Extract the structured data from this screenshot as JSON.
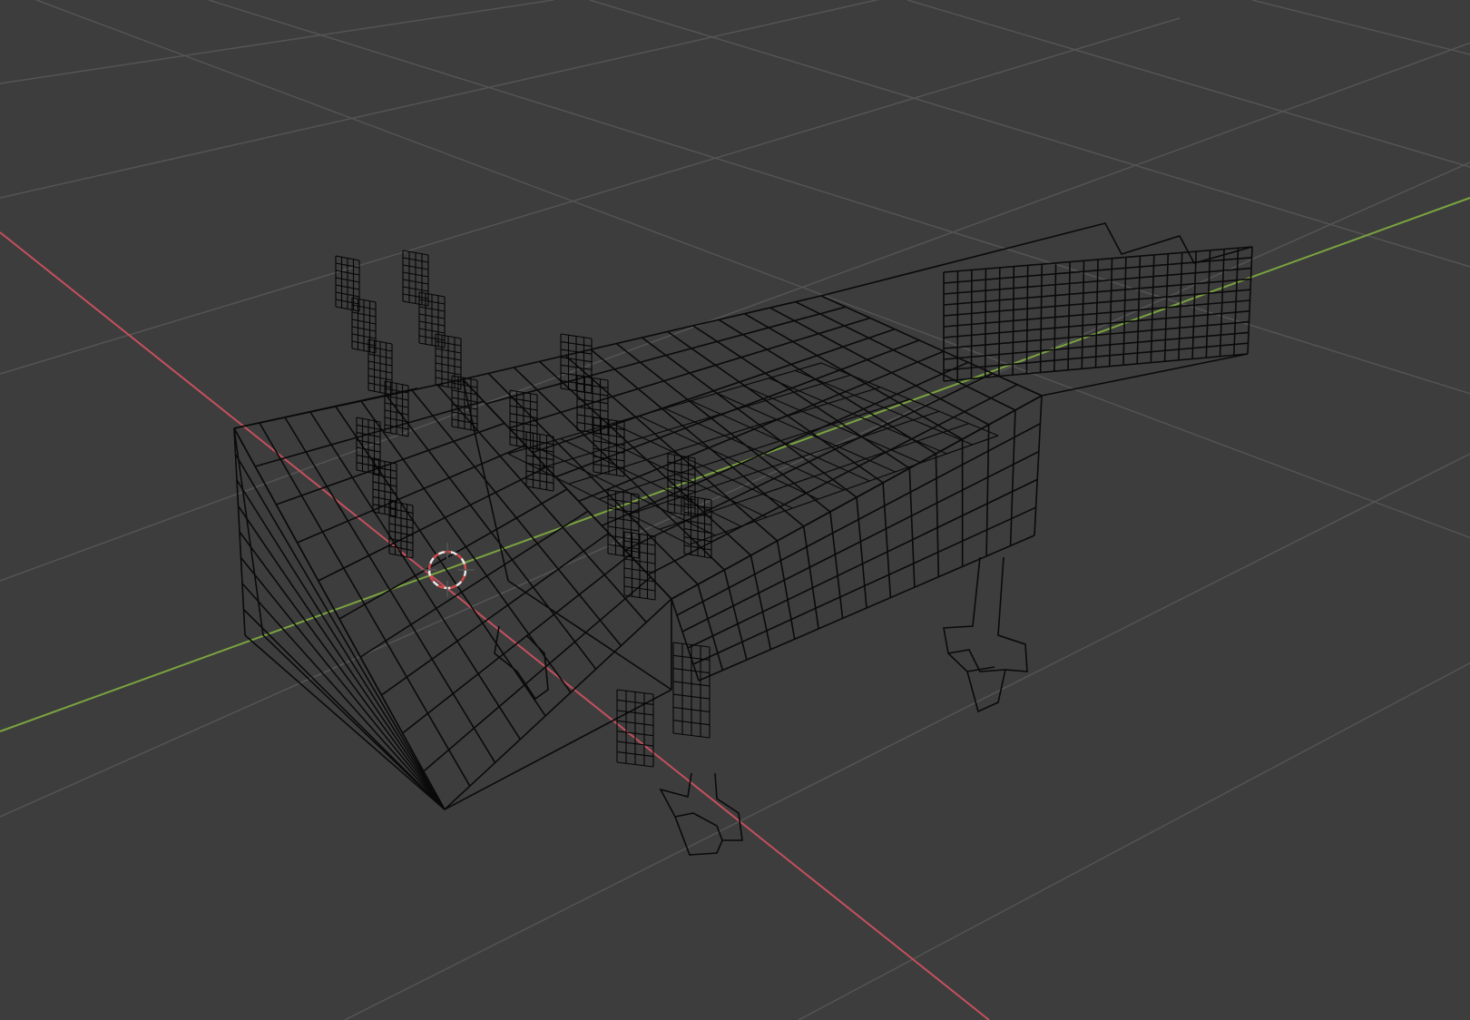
{
  "viewport": {
    "view_mode": "wireframe",
    "background_color": "#3d3d3d",
    "grid_color": "#545454",
    "wire_color": "#0a0a0a",
    "axes": {
      "x_axis_color": "#c4505e",
      "y_axis_color": "#7aa33f"
    },
    "cursor_3d": {
      "icon": "3d-cursor-icon",
      "ring_color_a": "#e8e8e8",
      "ring_color_b": "#d24a4a"
    },
    "object": {
      "type": "mesh",
      "name_visible": false
    }
  }
}
